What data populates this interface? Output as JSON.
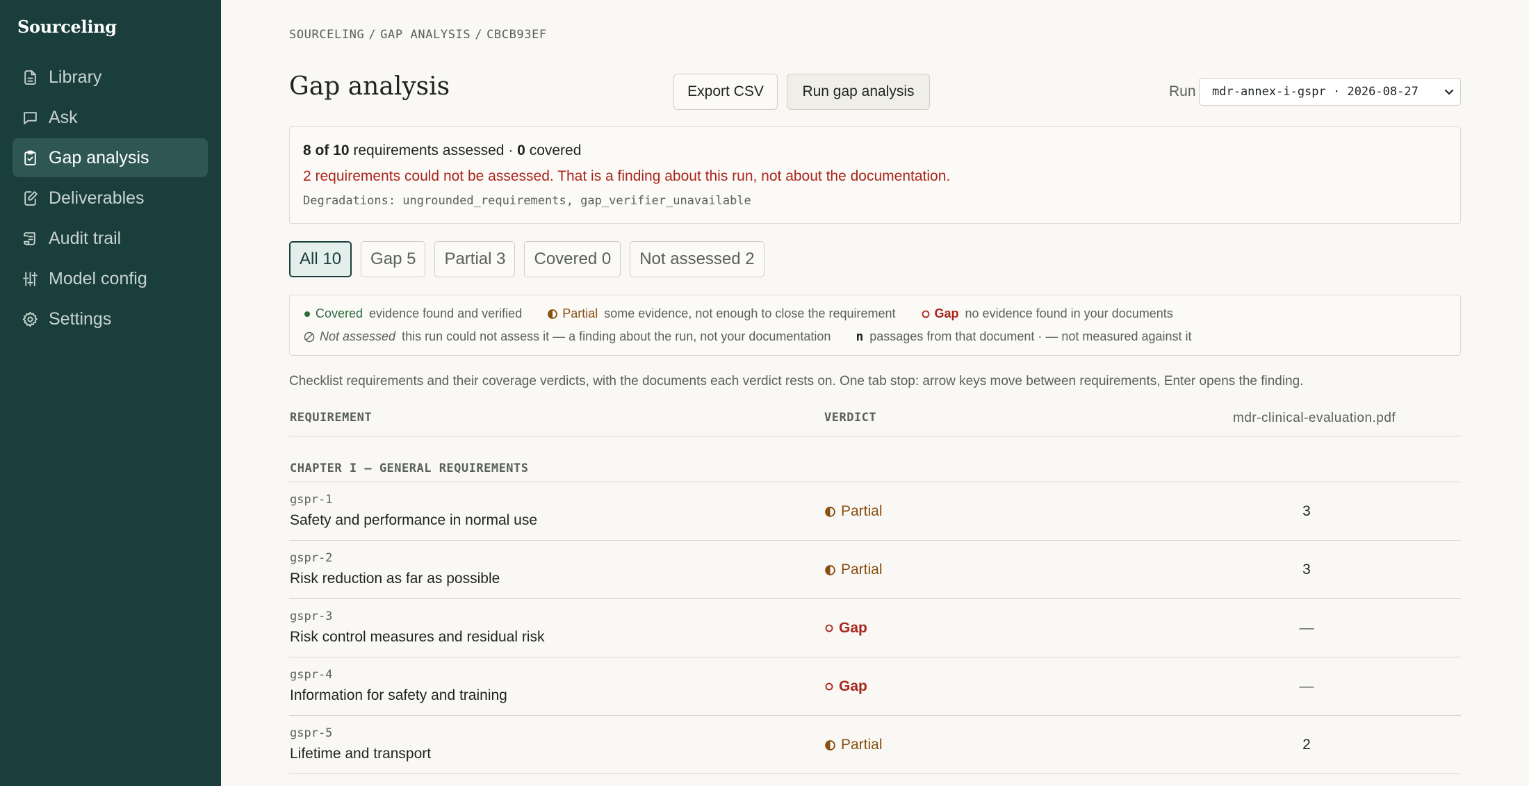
{
  "app": {
    "brand": "Sourceling"
  },
  "sidebar": {
    "items": [
      {
        "label": "Library",
        "icon": "document-icon",
        "active": false
      },
      {
        "label": "Ask",
        "icon": "chat-icon",
        "active": false
      },
      {
        "label": "Gap analysis",
        "icon": "clipboard-check-icon",
        "active": true
      },
      {
        "label": "Deliverables",
        "icon": "edit-document-icon",
        "active": false
      },
      {
        "label": "Audit trail",
        "icon": "scroll-icon",
        "active": false
      },
      {
        "label": "Model config",
        "icon": "sliders-icon",
        "active": false
      },
      {
        "label": "Settings",
        "icon": "gear-icon",
        "active": false
      }
    ]
  },
  "breadcrumb": [
    "SOURCELING",
    "GAP ANALYSIS",
    "CBCB93EF"
  ],
  "header": {
    "title": "Gap analysis",
    "export_label": "Export CSV",
    "run_label": "Run gap analysis",
    "run_select_label": "Run",
    "run_select_value": "mdr-annex-i-gspr · 2026-08-27"
  },
  "summary": {
    "assessed_count": "8 of 10",
    "assessed_text": "requirements assessed ·",
    "covered_count": "0",
    "covered_text": "covered",
    "warning": "2 requirements could not be assessed. That is a finding about this run, not about the documentation.",
    "degradations": "Degradations: ungrounded_requirements, gap_verifier_unavailable"
  },
  "filters": [
    {
      "label": "All 10",
      "active": true
    },
    {
      "label": "Gap 5",
      "active": false
    },
    {
      "label": "Partial 3",
      "active": false
    },
    {
      "label": "Covered 0",
      "active": false
    },
    {
      "label": "Not assessed 2",
      "active": false
    }
  ],
  "legend": {
    "covered": {
      "term": "Covered",
      "desc": "evidence found and verified",
      "color": "#2d6a3e"
    },
    "partial": {
      "term": "Partial",
      "desc": "some evidence, not enough to close the requirement",
      "color": "#8a4e10"
    },
    "gap": {
      "term": "Gap",
      "desc": "no evidence found in your documents",
      "color": "#a8261c"
    },
    "not_assessed": {
      "term": "Not assessed",
      "desc": "this run could not assess it — a finding about the run, not your documentation"
    },
    "n": {
      "term": "n",
      "desc": "passages from that document · — not measured against it"
    }
  },
  "caption": "Checklist requirements and their coverage verdicts, with the documents each verdict rests on. One tab stop: arrow keys move between requirements, Enter opens the finding.",
  "table": {
    "headers": {
      "requirement": "REQUIREMENT",
      "verdict": "VERDICT",
      "document": "mdr-clinical-evaluation.pdf"
    },
    "group": "CHAPTER I — GENERAL REQUIREMENTS",
    "rows": [
      {
        "id": "gspr-1",
        "title": "Safety and performance in normal use",
        "verdict": "Partial",
        "count": "3"
      },
      {
        "id": "gspr-2",
        "title": "Risk reduction as far as possible",
        "verdict": "Partial",
        "count": "3"
      },
      {
        "id": "gspr-3",
        "title": "Risk control measures and residual risk",
        "verdict": "Gap",
        "count": "—"
      },
      {
        "id": "gspr-4",
        "title": "Information for safety and training",
        "verdict": "Gap",
        "count": "—"
      },
      {
        "id": "gspr-5",
        "title": "Lifetime and transport",
        "verdict": "Partial",
        "count": "2"
      }
    ]
  }
}
